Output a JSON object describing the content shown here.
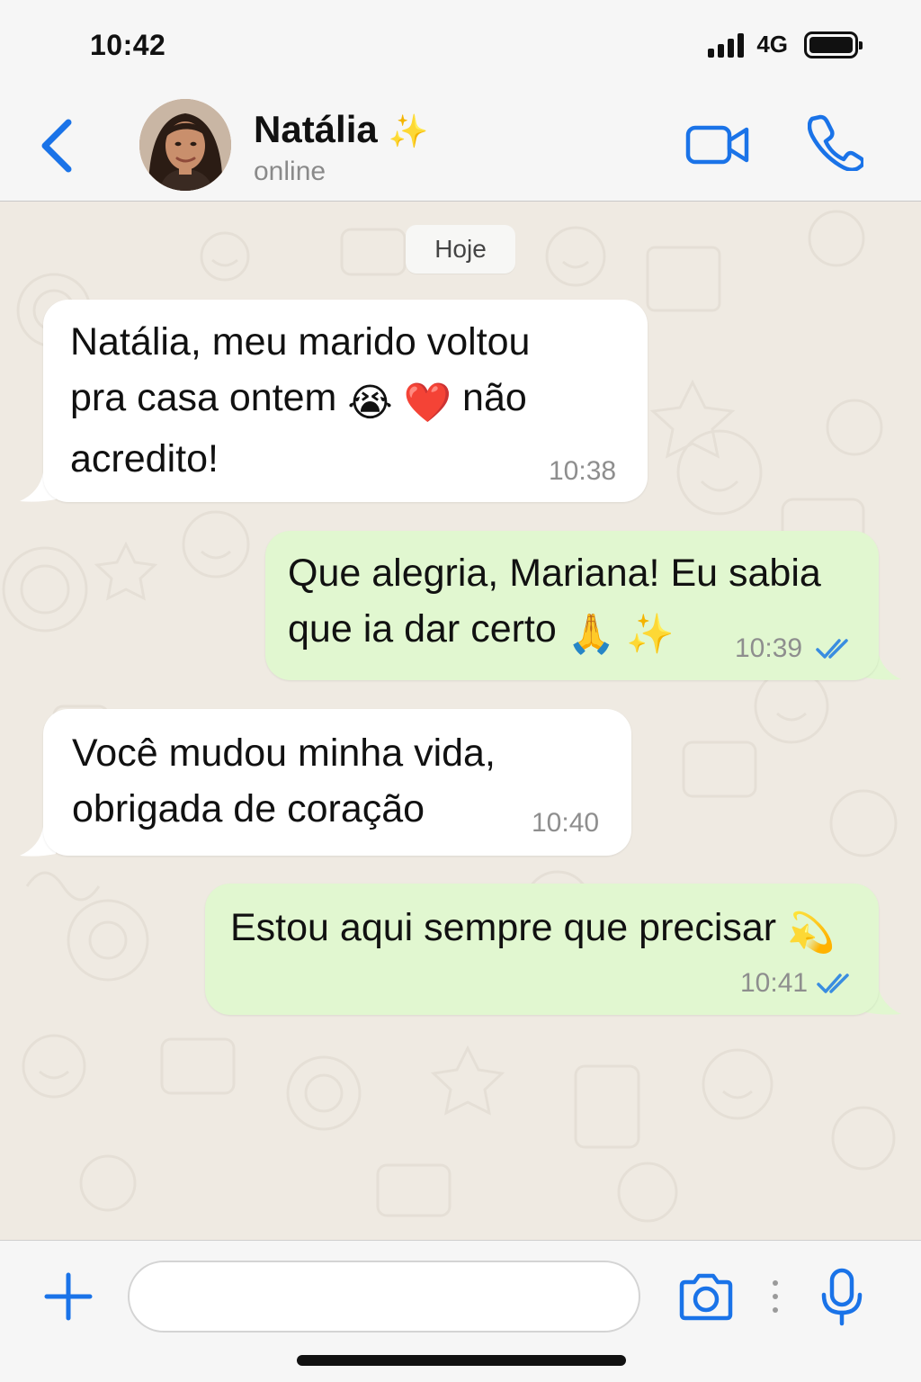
{
  "status_bar": {
    "time": "10:42",
    "network": "4G"
  },
  "header": {
    "contact_name": "Natália",
    "name_emoji": "✨",
    "status": "online",
    "icons": {
      "back": "chevron-left-icon",
      "video": "video-camera-icon",
      "call": "phone-icon"
    }
  },
  "chat": {
    "date_chip": "Hoje",
    "messages": [
      {
        "direction": "incoming",
        "line1": "Natália, meu marido voltou",
        "line2_a": "pra casa ontem",
        "line2_b": "não",
        "line3": "acredito!",
        "emoji1": "😭",
        "emoji2": "❤️",
        "time": "10:38"
      },
      {
        "direction": "outgoing",
        "line1": "Que alegria, Mariana! Eu sabia",
        "line2": "que ia dar certo",
        "emoji1": "🙏",
        "emoji2": "✨",
        "time": "10:39",
        "read": true
      },
      {
        "direction": "incoming",
        "line1": "Você mudou minha vida,",
        "line2": "obrigada de coração",
        "time": "10:40"
      },
      {
        "direction": "outgoing",
        "line1": "Estou aqui sempre que precisar",
        "emoji1": "💫",
        "time": "10:41",
        "read": true
      }
    ]
  },
  "input_bar": {
    "placeholder": "",
    "icons": {
      "plus": "plus-icon",
      "camera": "camera-icon",
      "more": "vertical-dots-icon",
      "mic": "microphone-icon"
    }
  },
  "colors": {
    "accent": "#1a73e8",
    "incoming_bubble": "#ffffff",
    "outgoing_bubble": "#e1f7d0",
    "chat_background": "#efeae2",
    "read_ticks": "#3a8de0"
  }
}
